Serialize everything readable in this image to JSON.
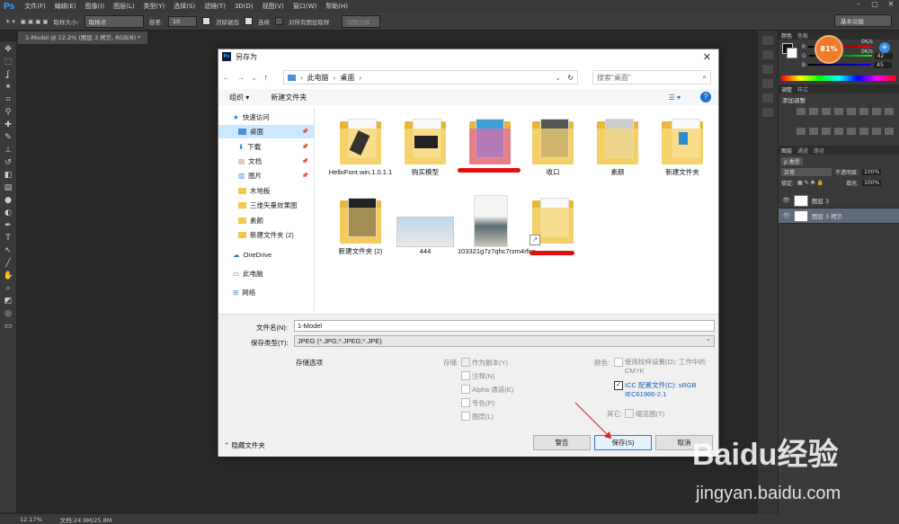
{
  "ps": {
    "logo": "Ps",
    "menu": [
      "文件(F)",
      "编辑(E)",
      "图像(I)",
      "图层(L)",
      "类型(Y)",
      "选择(S)",
      "滤镜(T)",
      "3D(D)",
      "视图(V)",
      "窗口(W)",
      "帮助(H)"
    ],
    "options": {
      "sample_size_label": "取样大小:",
      "sample_size_value": "取样点",
      "tolerance_label": "容差:",
      "tolerance_value": "10",
      "antialias": "消除锯齿",
      "contiguous": "连续",
      "all_layers": "对所有图层取样",
      "refine_edge": "调整边缘..."
    },
    "workspace": "基本功能",
    "doc_tab": "1-Model @ 12.2% (图层 3 拷贝, RGB/8) *",
    "status_zoom": "12.17%",
    "status_doc": "文档:24.9M/25.8M",
    "panels": {
      "color_tabs": [
        "颜色",
        "色板"
      ],
      "r": "",
      "g": "42",
      "b": "45",
      "adjust_tabs": [
        "调整",
        "样式"
      ],
      "adjust_title": "添加调整",
      "layers_tabs": [
        "图层",
        "通道",
        "路径"
      ],
      "kind_label": "ρ 类型",
      "blend_mode": "正常",
      "opacity_label": "不透明度:",
      "opacity_value": "100%",
      "lock_label": "锁定:",
      "fill_label": "填充:",
      "fill_value": "100%",
      "layers": [
        {
          "name": "图层 3",
          "selected": false
        },
        {
          "name": "图层 3 拷贝",
          "selected": true
        }
      ]
    },
    "speed_widget": {
      "percent": "81%",
      "up": "0K/s",
      "down": "0K/s",
      "plus": "+"
    }
  },
  "dialog": {
    "title": "另存为",
    "close": "✕",
    "nav": {
      "back": "←",
      "forward": "→",
      "recent": "⌄",
      "up": "↑"
    },
    "breadcrumb": [
      "此电脑",
      "桌面"
    ],
    "refresh": "↻",
    "search_placeholder": "搜索\"桌面\"",
    "organize": "组织 ▾",
    "new_folder": "新建文件夹",
    "view": "☰ ▾",
    "help": "?",
    "nav_pane": [
      {
        "label": "快速访问",
        "icon": "star"
      },
      {
        "label": "桌面",
        "icon": "folder-blue",
        "pinned": true
      },
      {
        "label": "下载",
        "icon": "download",
        "pinned": true
      },
      {
        "label": "文档",
        "icon": "doc",
        "pinned": true
      },
      {
        "label": "图片",
        "icon": "picture",
        "pinned": true
      },
      {
        "label": "木地板",
        "icon": "folder"
      },
      {
        "label": "三维矢量效果图",
        "icon": "folder"
      },
      {
        "label": "素颜",
        "icon": "folder"
      },
      {
        "label": "新建文件夹 (2)",
        "icon": "folder"
      },
      {
        "label": "OneDrive",
        "icon": "cloud"
      },
      {
        "label": "此电脑",
        "icon": "pc"
      },
      {
        "label": "网络",
        "icon": "network"
      }
    ],
    "files": [
      {
        "name": "HelloFont.win.1.0.1.1",
        "type": "folder"
      },
      {
        "name": "购买模型",
        "type": "folder"
      },
      {
        "name": "",
        "type": "folder",
        "redacted": true
      },
      {
        "name": "收口",
        "type": "folder"
      },
      {
        "name": "素颜",
        "type": "folder"
      },
      {
        "name": "新建文件夹",
        "type": "folder"
      },
      {
        "name": "新建文件夹 (2)",
        "type": "folder"
      },
      {
        "name": "444",
        "type": "image"
      },
      {
        "name": "103321g7z7qhc7rzm4rfoc",
        "type": "image"
      },
      {
        "name": "",
        "type": "shortcut",
        "redacted": true
      }
    ],
    "filename_label": "文件名(N):",
    "filename_value": "1-Model",
    "filetype_label": "保存类型(T):",
    "filetype_value": "JPEG (*.JPG;*.JPEG;*.JPE)",
    "save_options_label": "存储选项",
    "storage_label": "存储:",
    "opts": [
      "作为副本(Y)",
      "注释(N)",
      "Alpha 通道(E)",
      "专色(P)",
      "图层(L)"
    ],
    "color_label": "颜色:",
    "proof_setup": "使用校样设置(O): 工作中的 CMYK",
    "icc_profile": "ICC 配置文件(C): sRGB IEC61966-2.1",
    "other_label": "其它:",
    "thumbnail": "缩览图(T)",
    "hide_folders": "隐藏文件夹",
    "btn_warning": "警告",
    "btn_save": "保存(S)",
    "btn_cancel": "取消"
  },
  "watermark": {
    "brand": "Baidu经验",
    "url": "jingyan.baidu.com"
  }
}
